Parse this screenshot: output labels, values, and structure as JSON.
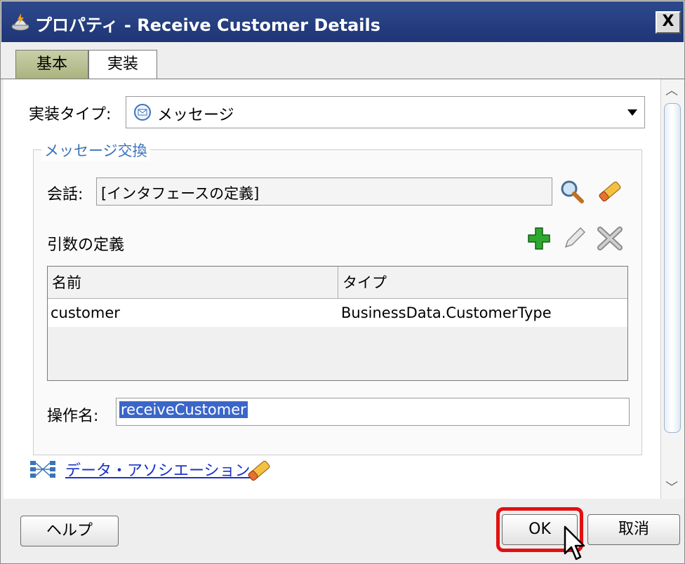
{
  "window": {
    "title": "プロパティ - Receive Customer Details",
    "close_label": "X"
  },
  "tabs": [
    {
      "label": "基本"
    },
    {
      "label": "実装"
    }
  ],
  "impl_type": {
    "label": "実装タイプ:",
    "value": "メッセージ"
  },
  "message_exchange": {
    "group_title": "メッセージ交換",
    "conversation_label": "会話:",
    "conversation_value": "[インタフェースの定義]",
    "args_label": "引数の定義",
    "table": {
      "headers": [
        "名前",
        "タイプ"
      ],
      "rows": [
        [
          "customer",
          "BusinessData.CustomerType"
        ]
      ]
    },
    "operation_label": "操作名:",
    "operation_value": "receiveCustomer"
  },
  "data_association_link": "データ・アソシエーション",
  "buttons": {
    "help": "ヘルプ",
    "ok": "OK",
    "cancel": "取消"
  },
  "colors": {
    "titlebar": "#1f3576",
    "highlight": "#e21010",
    "link": "#1a33c8",
    "selection": "#3b66c9"
  },
  "icons": [
    "app-icon",
    "message-icon",
    "search-icon",
    "eraser-icon",
    "add-icon",
    "edit-icon",
    "delete-icon",
    "data-association-icon",
    "cursor-icon"
  ]
}
